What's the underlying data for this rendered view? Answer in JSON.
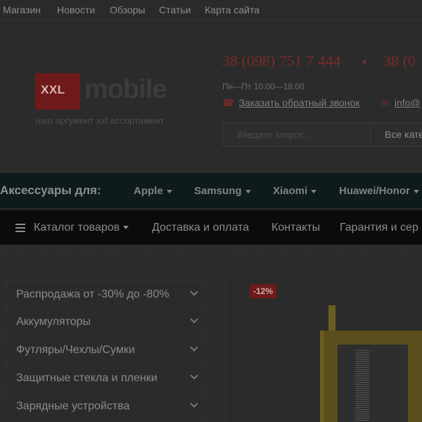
{
  "topbar": {
    "links": [
      "Магазин",
      "Новости",
      "Обзоры",
      "Статьи",
      "Карта сайта"
    ]
  },
  "logo": {
    "box_text": "XXL",
    "word": "mobile",
    "tagline": "наш аргумент xxl ассортимент"
  },
  "contacts": {
    "phone_1": "38 (098) 751 7 444",
    "phone_2": "38 (0",
    "separator": "•",
    "hours": "Пн—Пт 10:00—18:00",
    "callback_label": "Заказать обратный звонок",
    "email_label": "info@"
  },
  "search": {
    "placeholder": "Введите запрос...",
    "category_select": "Все катего"
  },
  "accessories_bar": {
    "title": "Аксессуары для:",
    "items": [
      "Apple",
      "Samsung",
      "Xiaomi",
      "Huawei/Honor"
    ]
  },
  "main_nav": {
    "items": [
      "Каталог товаров",
      "Доставка и оплата",
      "Контакты",
      "Гарантия и сер"
    ]
  },
  "sidebar": {
    "categories": [
      "Распродажа от -30% до -80%",
      "Аккумуляторы",
      "Футляры/Чехлы/Сумки",
      "Защитные стекла и пленки",
      "Зарядные устройства"
    ]
  },
  "product": {
    "discount_badge": "-12%"
  },
  "colors": {
    "accent": "#7a2a2a",
    "accessories_bar_bg": "#0e1a1c",
    "nav_bg": "#0b0b0b"
  }
}
